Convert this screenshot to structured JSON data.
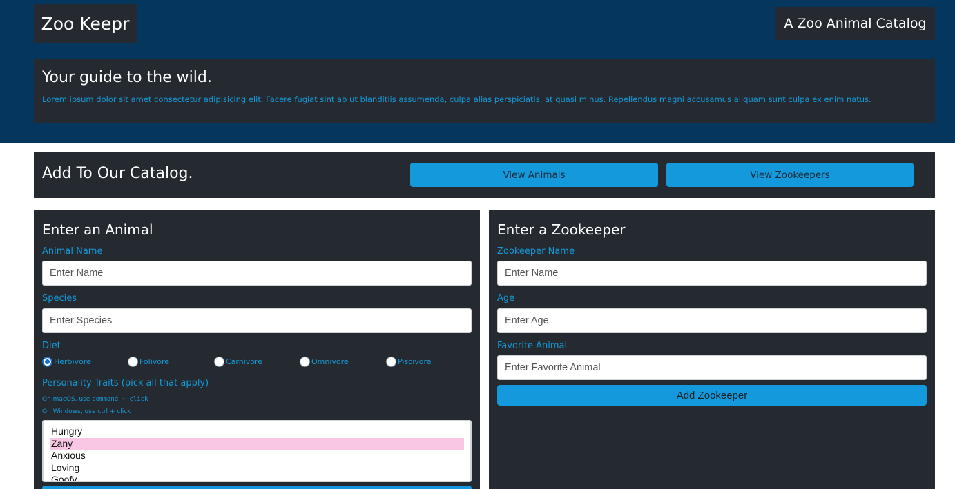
{
  "header": {
    "brand": "Zoo Keepr",
    "tagline": "A Zoo Animal Catalog"
  },
  "hero": {
    "title": "Your guide to the wild.",
    "text": "Lorem ipsum dolor sit amet consectetur adipisicing elit. Facere fugiat sint ab ut blanditiis assumenda, culpa alias perspiciatis, at quasi minus. Repellendus magni accusamus aliquam sunt culpa ex enim natus."
  },
  "catalog": {
    "title": "Add To Our Catalog.",
    "view_animals_label": "View Animals",
    "view_zookeepers_label": "View Zookeepers"
  },
  "animal_form": {
    "title": "Enter an Animal",
    "name_label": "Animal Name",
    "name_placeholder": "Enter Name",
    "species_label": "Species",
    "species_placeholder": "Enter Species",
    "diet_label": "Diet",
    "diet_options": [
      {
        "label": "Herbivore",
        "checked": true
      },
      {
        "label": "Folivore",
        "checked": false
      },
      {
        "label": "Carnivore",
        "checked": false
      },
      {
        "label": "Omnivore",
        "checked": false
      },
      {
        "label": "Piscivore",
        "checked": false
      }
    ],
    "traits_label": "Personality Traits (pick all that apply)",
    "hint_mac_prefix": "On macOS, use ",
    "hint_mac_code": "command + click",
    "hint_windows": "On Windows, use ctrl + click",
    "traits": [
      {
        "label": "Hungry",
        "selected": false
      },
      {
        "label": "Zany",
        "selected": true
      },
      {
        "label": "Anxious",
        "selected": false
      },
      {
        "label": "Loving",
        "selected": false
      },
      {
        "label": "Goofy",
        "selected": false
      }
    ]
  },
  "zookeeper_form": {
    "title": "Enter a Zookeeper",
    "name_label": "Zookeeper Name",
    "name_placeholder": "Enter Name",
    "age_label": "Age",
    "age_placeholder": "Enter Age",
    "favorite_label": "Favorite Animal",
    "favorite_placeholder": "Enter Favorite Animal",
    "submit_label": "Add Zookeeper"
  },
  "colors": {
    "hero_bg": "#05365d",
    "panel_bg": "#252a31",
    "accent": "#1599d8",
    "button_bg": "#1399dc",
    "selected_option": "#f9c7e3"
  }
}
